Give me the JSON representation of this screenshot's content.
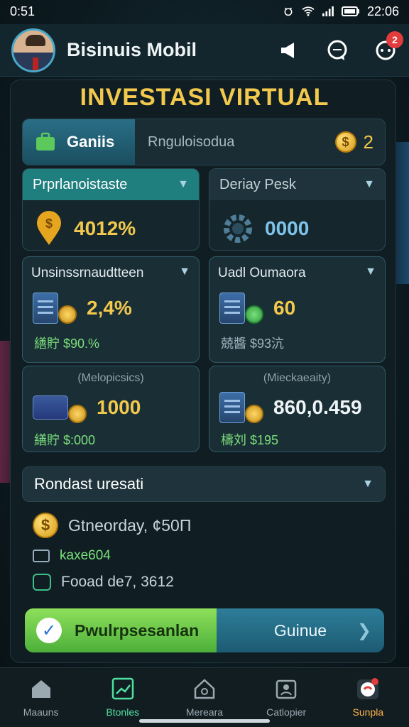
{
  "status": {
    "left_time": "0:51",
    "right_time": "22:06"
  },
  "header": {
    "app_title": "Bisinuis Mobil",
    "notification_count": "2"
  },
  "panel_title": "INVESTASI VIRTUAL",
  "tabs": {
    "active": "Ganiis",
    "other": "Rnguloisodua",
    "coin_count": "2",
    "coin_symbol": "$"
  },
  "top_cards": [
    {
      "title": "Prprlanoistaste",
      "value": "4012%"
    },
    {
      "title": "Deriay Pesk",
      "value": "0000"
    }
  ],
  "grid_cards": [
    {
      "title": "Unsinssrnaudtteen",
      "value": "2,4%",
      "sub": "繕貯 $90.%"
    },
    {
      "title": "Uadl Oumaora",
      "value": "60",
      "sub": "兢醬 $93沆"
    },
    {
      "subtitle": "(Melopicsics)",
      "value": "1000",
      "sub": "繕貯 $:000"
    },
    {
      "subtitle": "(Mieckaeaity)",
      "value": "860,0.459",
      "sub": "檮刘 $195"
    }
  ],
  "section": {
    "title": "Rondast uresati"
  },
  "list": [
    {
      "text": "Gtneorday, ¢50Π"
    },
    {
      "text": "kaxe604"
    },
    {
      "text": "Fooad de7, 3612"
    }
  ],
  "buttons": {
    "green": "Pwulrpsesanlan",
    "blue": "Guinue"
  },
  "nav": [
    {
      "label": "Maauns"
    },
    {
      "label": "Btonles"
    },
    {
      "label": "Mereara"
    },
    {
      "label": "Catlopier"
    },
    {
      "label": "Sunpla"
    }
  ]
}
